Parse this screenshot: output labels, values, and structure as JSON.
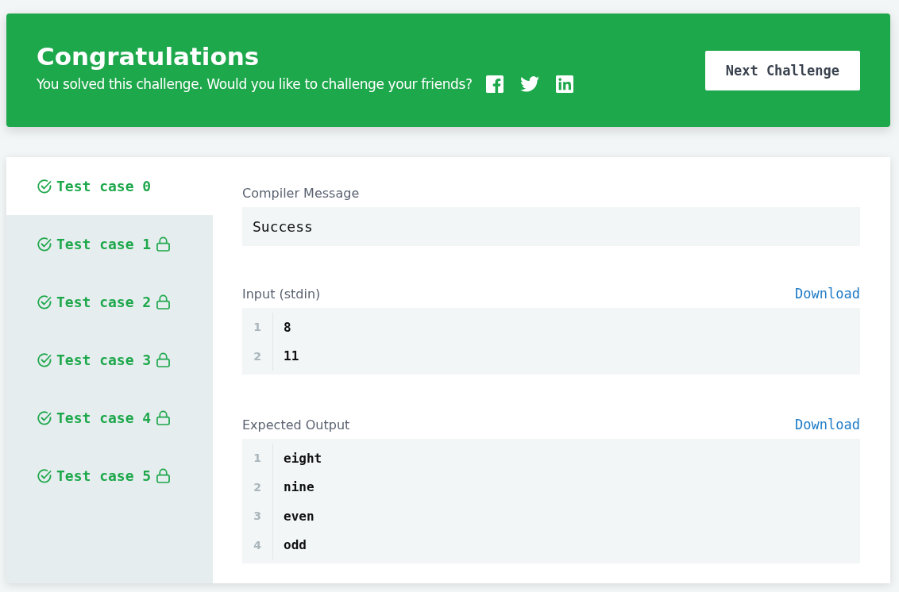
{
  "banner": {
    "title": "Congratulations",
    "message": "You solved this challenge. Would you like to challenge your friends?",
    "button": "Next Challenge"
  },
  "test_cases": [
    {
      "label": "Test case 0",
      "selected": true,
      "locked": false
    },
    {
      "label": "Test case 1",
      "selected": false,
      "locked": true
    },
    {
      "label": "Test case 2",
      "selected": false,
      "locked": true
    },
    {
      "label": "Test case 3",
      "selected": false,
      "locked": true
    },
    {
      "label": "Test case 4",
      "selected": false,
      "locked": true
    },
    {
      "label": "Test case 5",
      "selected": false,
      "locked": true
    }
  ],
  "compiler_message": {
    "label": "Compiler Message",
    "value": "Success"
  },
  "sections": [
    {
      "label": "Input (stdin)",
      "download": "Download",
      "lines": [
        {
          "number": "1",
          "text": "8"
        },
        {
          "number": "2",
          "text": "11"
        }
      ]
    },
    {
      "label": "Expected Output",
      "download": "Download",
      "lines": [
        {
          "number": "1",
          "text": "eight"
        },
        {
          "number": "2",
          "text": "nine"
        },
        {
          "number": "3",
          "text": "even"
        },
        {
          "number": "4",
          "text": "odd"
        }
      ]
    }
  ]
}
